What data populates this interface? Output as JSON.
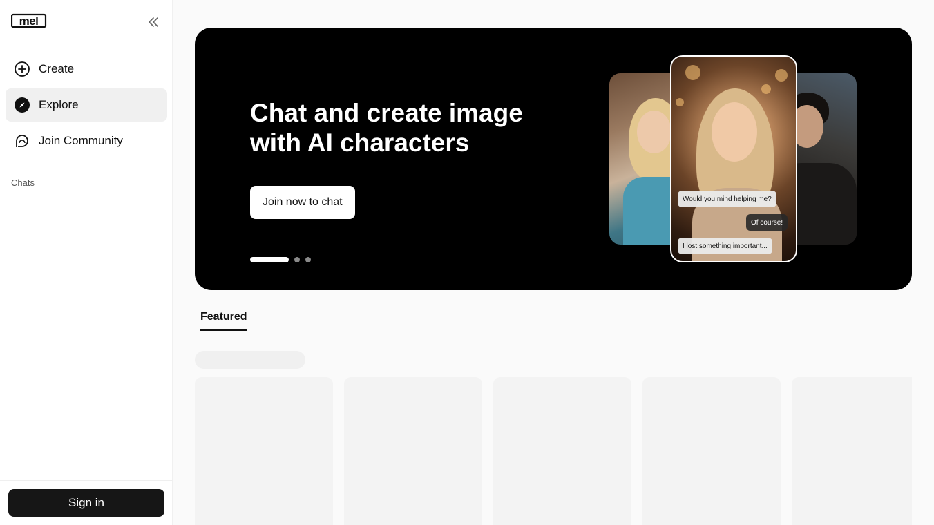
{
  "sidebar": {
    "logo_text": "mel",
    "nav": [
      {
        "label": "Create",
        "icon": "plus-circle-icon",
        "active": false
      },
      {
        "label": "Explore",
        "icon": "compass-icon",
        "active": true
      },
      {
        "label": "Join Community",
        "icon": "chat-bubble-icon",
        "active": false
      }
    ],
    "section_label": "Chats",
    "signin_label": "Sign in"
  },
  "hero": {
    "title": "Chat and create image with AI characters",
    "cta_label": "Join now to chat",
    "slide_count": 3,
    "active_slide": 1,
    "bubbles": [
      "Would you mind helping me?",
      "Of course!",
      "I lost something important..."
    ]
  },
  "tabs": [
    {
      "label": "Featured",
      "active": true
    }
  ],
  "colors": {
    "hero_bg": "#000000",
    "sidebar_bg": "#ffffff",
    "page_bg": "#fafafa",
    "signin_bg": "#161616"
  }
}
